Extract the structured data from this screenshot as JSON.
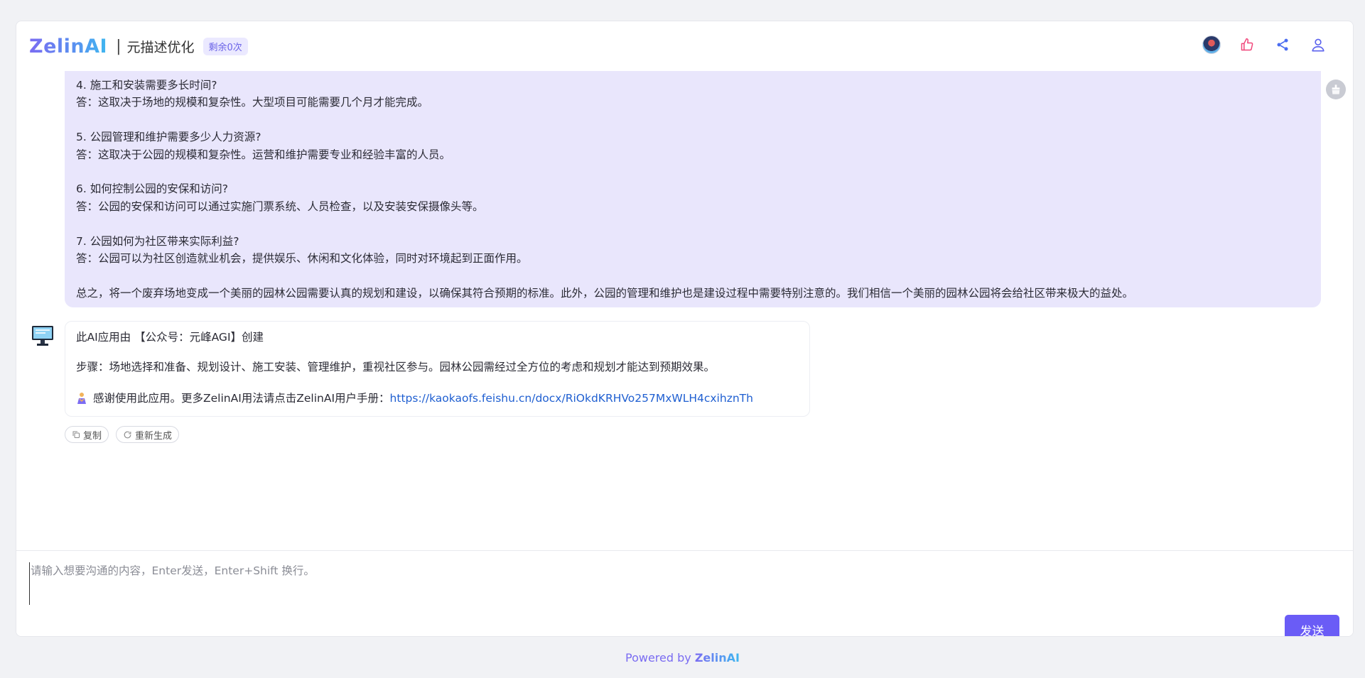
{
  "header": {
    "logo_text": "ZelinAI",
    "separator": "|",
    "app_title": "元描述优化",
    "quota_badge": "剩余0次"
  },
  "icons": {
    "avatar": "avatar-icon",
    "like": "thumbs-up-icon",
    "share": "share-icon",
    "user": "user-icon",
    "clear": "clear-icon",
    "copy": "copy-icon",
    "regenerate": "refresh-icon",
    "bot": "computer-bot-icon",
    "thanks": "person-thanks-icon"
  },
  "colors": {
    "accent": "#6a5cf6",
    "like_icon": "#f0467a",
    "link": "#1f5fd1",
    "ai_bubble_bg": "#e9e6fc"
  },
  "chat": {
    "previous_answer": {
      "lines": [
        "4. 施工和安装需要多长时间?",
        "答：这取决于场地的规模和复杂性。大型项目可能需要几个月才能完成。",
        "",
        "5. 公园管理和维护需要多少人力资源?",
        "答：这取决于公园的规模和复杂性。运营和维护需要专业和经验丰富的人员。",
        "",
        "6. 如何控制公园的安保和访问?",
        "答：公园的安保和访问可以通过实施门票系统、人员检查，以及安装安保摄像头等。",
        "",
        "7. 公园如何为社区带来实际利益?",
        "答：公园可以为社区创造就业机会，提供娱乐、休闲和文化体验，同时对环境起到正面作用。",
        "",
        "总之，将一个废弃场地变成一个美丽的园林公园需要认真的规划和建设，以确保其符合预期的标准。此外，公园的管理和维护也是建设过程中需要特别注意的。我们相信一个美丽的园林公园将会给社区带来极大的益处。"
      ]
    },
    "latest_answer": {
      "created_by": "此AI应用由 【公众号：元峰AGI】创建",
      "steps": "步骤：场地选择和准备、规划设计、施工安装、管理维护，重视社区参与。园林公园需经过全方位的考虑和规划才能达到预期效果。",
      "thanks_text": "感谢使用此应用。更多ZelinAI用法请点击ZelinAI用户手册：",
      "manual_link": "https://kaokaofs.feishu.cn/docx/RiOkdKRHVo257MxWLH4cxihznTh"
    },
    "actions": {
      "copy_label": "复制",
      "regenerate_label": "重新生成"
    }
  },
  "input": {
    "placeholder": "请输入想要沟通的内容，Enter发送，Enter+Shift 换行。",
    "value": "",
    "send_label": "发送"
  },
  "footer": {
    "powered_by": "Powered by ",
    "brand": "ZelinAI"
  }
}
